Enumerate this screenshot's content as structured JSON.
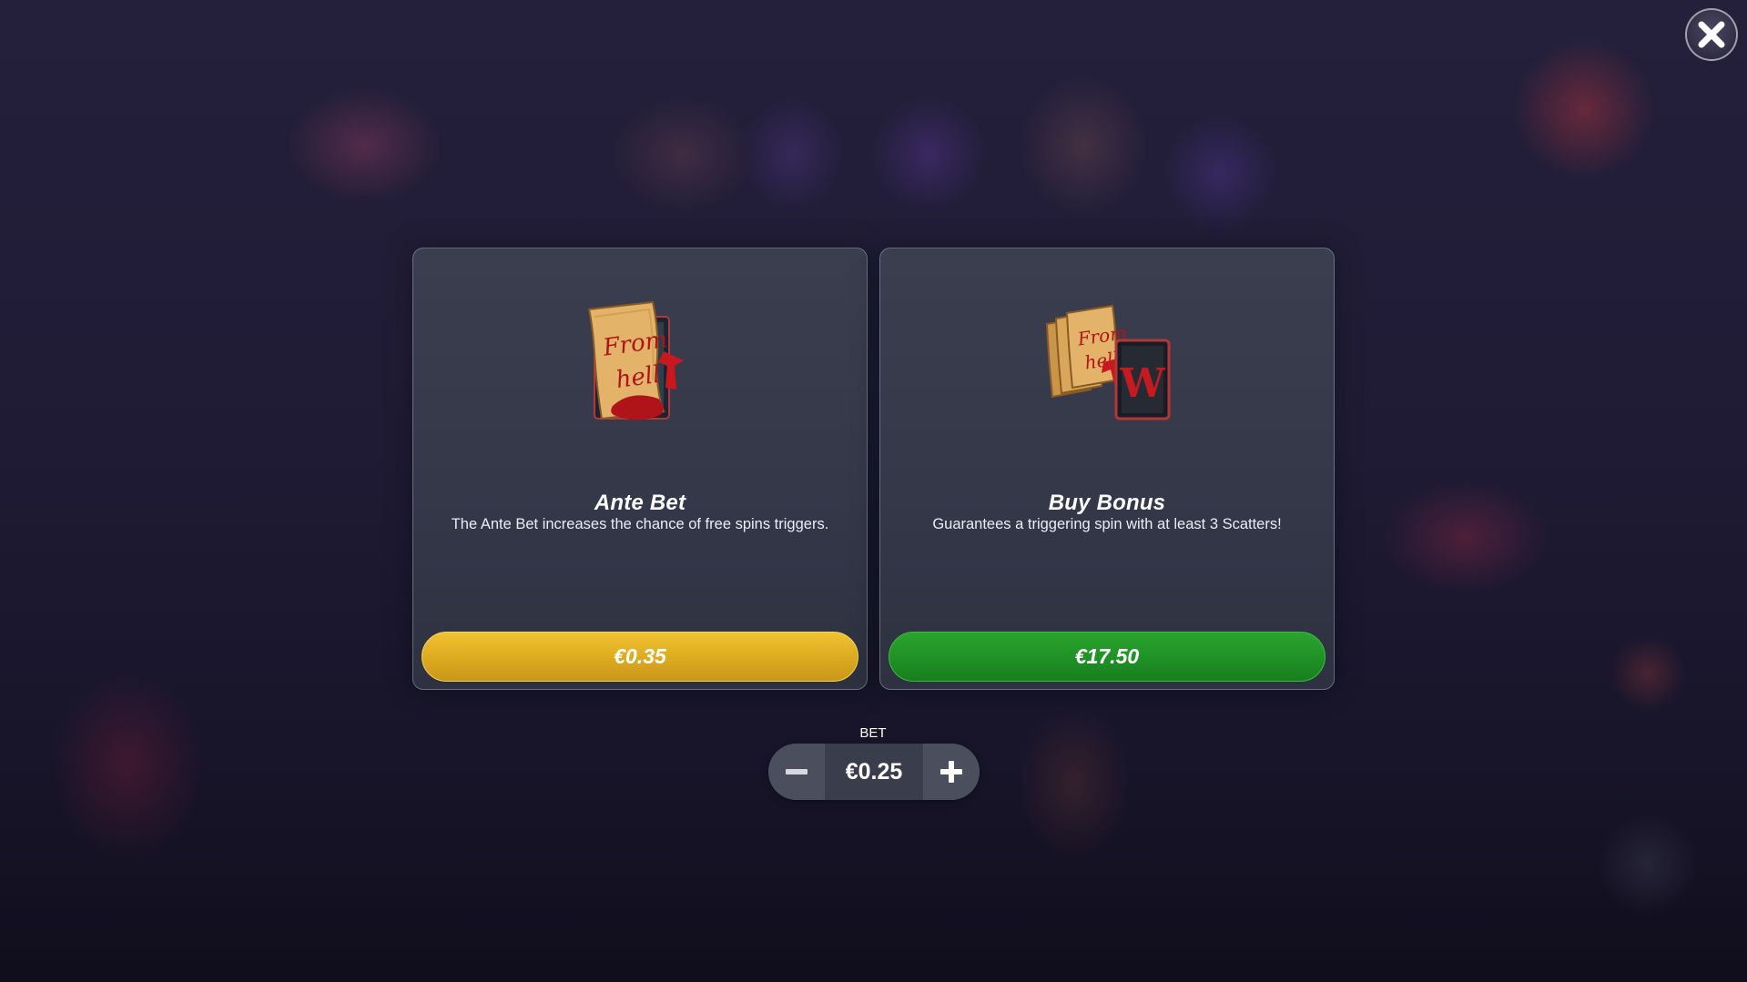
{
  "close": {
    "icon": "close-icon"
  },
  "ante": {
    "title": "Ante Bet",
    "description": "The Ante Bet increases the chance of free spins triggers.",
    "price": "€0.35",
    "art_text_line1": "From",
    "art_text_line2": "hell",
    "button_color": "#dcaa1f"
  },
  "buy": {
    "title": "Buy Bonus",
    "description": "Guarantees a triggering spin with at least 3 Scatters!",
    "price": "€17.50",
    "art_text_line1": "From",
    "art_text_line2": "hell",
    "art_letter": "W",
    "button_color": "#1f9125"
  },
  "bet": {
    "label": "BET",
    "value": "€0.25",
    "minus_icon": "minus-icon",
    "plus_icon": "plus-icon"
  }
}
